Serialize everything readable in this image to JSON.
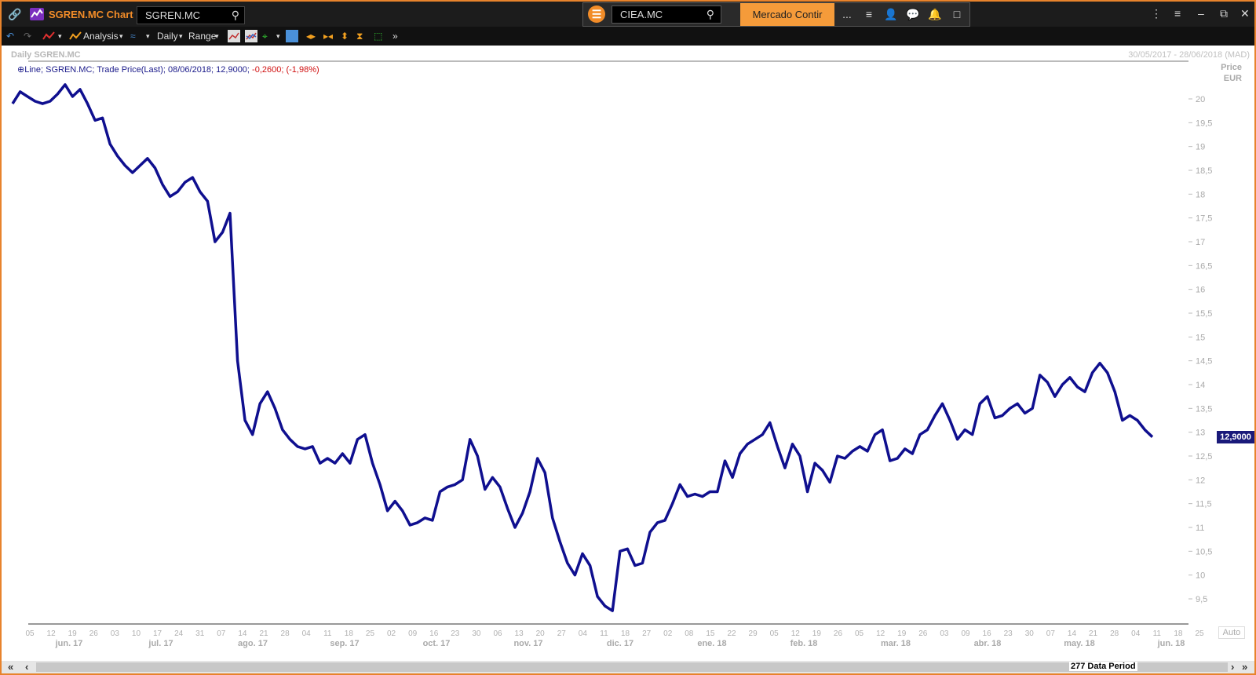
{
  "window": {
    "title": "SGREN.MC Chart",
    "ric": "SGREN.MC",
    "search_value": "CIEA.MC",
    "mercado_tab": "Mercado Contir",
    "more_label": "..."
  },
  "toolbar": {
    "analysis_label": "Analysis",
    "interval_label": "Daily",
    "range_label": "Range"
  },
  "chart_header": {
    "title": "Daily SGREN.MC",
    "date_range": "30/05/2017 - 28/06/2018 (MAD)",
    "legend": {
      "series_desc": "Line; SGREN.MC; Trade Price(Last); 08/06/2018; 12,9000;",
      "change_text": "-0,2600; (-1,98%)"
    },
    "axis_title": "Price",
    "axis_unit": "EUR",
    "last_value": "12,9000",
    "auto_label": "Auto"
  },
  "scrollbar": {
    "period_label": "277 Data Period"
  },
  "colors": {
    "line": "#0f0f8f",
    "accent": "#e8832c",
    "negative": "#d01010"
  },
  "chart_data": {
    "type": "line",
    "title": "Daily SGREN.MC",
    "ylabel": "Price EUR",
    "ylim": [
      9.0,
      20.5
    ],
    "y_ticks": [
      "20",
      "19,5",
      "19",
      "18,5",
      "18",
      "17,5",
      "17",
      "16,5",
      "16",
      "15,5",
      "15",
      "14,5",
      "14",
      "13,5",
      "13",
      "12,5",
      "12",
      "11,5",
      "11",
      "10,5",
      "10",
      "9,5"
    ],
    "x_day_ticks": [
      "05",
      "12",
      "19",
      "26",
      "03",
      "10",
      "17",
      "24",
      "31",
      "07",
      "14",
      "21",
      "28",
      "04",
      "11",
      "18",
      "25",
      "02",
      "09",
      "16",
      "23",
      "30",
      "06",
      "13",
      "20",
      "27",
      "04",
      "11",
      "18",
      "27",
      "02",
      "08",
      "15",
      "22",
      "29",
      "05",
      "12",
      "19",
      "26",
      "05",
      "12",
      "19",
      "26",
      "03",
      "09",
      "16",
      "23",
      "30",
      "07",
      "14",
      "21",
      "28",
      "04",
      "11",
      "18",
      "25"
    ],
    "x_month_labels": [
      "jun. 17",
      "jul. 17",
      "ago. 17",
      "sep. 17",
      "oct. 17",
      "nov. 17",
      "dic. 17",
      "ene. 18",
      "feb. 18",
      "mar. 18",
      "abr. 18",
      "may. 18",
      "jun. 18"
    ],
    "series": [
      {
        "values": [
          19.9,
          20.15,
          20.05,
          19.95,
          19.9,
          19.95,
          20.1,
          20.3,
          20.05,
          20.2,
          19.9,
          19.55,
          19.6,
          19.05,
          18.8,
          18.6,
          18.45,
          18.6,
          18.75,
          18.55,
          18.2,
          17.95,
          18.05,
          18.25,
          18.35,
          18.05,
          17.85,
          17.0,
          17.2,
          17.6,
          14.5,
          13.25,
          12.95,
          13.6,
          13.85,
          13.5,
          13.05,
          12.85,
          12.7,
          12.65,
          12.7,
          12.35,
          12.45,
          12.35,
          12.55,
          12.35,
          12.85,
          12.95,
          12.35,
          11.9,
          11.35,
          11.55,
          11.35,
          11.05,
          11.1,
          11.2,
          11.15,
          11.75,
          11.85,
          11.9,
          12.0,
          12.85,
          12.5,
          11.8,
          12.05,
          11.85,
          11.4,
          11.0,
          11.3,
          11.75,
          12.45,
          12.15,
          11.2,
          10.7,
          10.25,
          10.0,
          10.45,
          10.2,
          9.55,
          9.35,
          9.25,
          10.5,
          10.55,
          10.2,
          10.25,
          10.9,
          11.1,
          11.15,
          11.5,
          11.9,
          11.65,
          11.7,
          11.65,
          11.75,
          11.75,
          12.4,
          12.05,
          12.55,
          12.75,
          12.85,
          12.95,
          13.2,
          12.7,
          12.25,
          12.75,
          12.5,
          11.75,
          12.35,
          12.2,
          11.95,
          12.5,
          12.45,
          12.6,
          12.7,
          12.6,
          12.95,
          13.05,
          12.4,
          12.45,
          12.65,
          12.55,
          12.95,
          13.05,
          13.35,
          13.6,
          13.25,
          12.85,
          13.05,
          12.95,
          13.6,
          13.75,
          13.3,
          13.35,
          13.5,
          13.6,
          13.4,
          13.5,
          14.2,
          14.05,
          13.75,
          14.0,
          14.15,
          13.95,
          13.85,
          14.25,
          14.45,
          14.25,
          13.85,
          13.25,
          13.35,
          13.25,
          13.05,
          12.9
        ]
      }
    ]
  }
}
